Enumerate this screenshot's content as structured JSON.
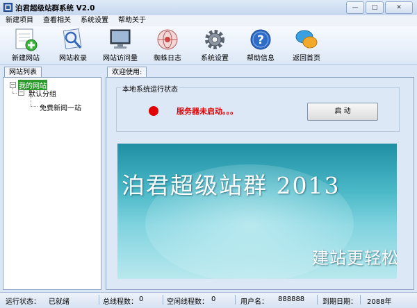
{
  "window": {
    "title": "泊君超级站群系统 V2.0",
    "buttons": {
      "minimize": "—",
      "maximize": "□",
      "close": "✕"
    }
  },
  "menu": [
    "新建项目",
    "查看相关",
    "系统设置",
    "帮助关于"
  ],
  "toolbar": [
    {
      "label": "新建网站",
      "icon": "new-site-icon"
    },
    {
      "label": "网站收录",
      "icon": "site-index-icon"
    },
    {
      "label": "网站访问量",
      "icon": "site-traffic-icon"
    },
    {
      "label": "蜘蛛日志",
      "icon": "spider-log-icon"
    },
    {
      "label": "系统设置",
      "icon": "gear-icon"
    },
    {
      "label": "帮助信息",
      "icon": "help-icon"
    },
    {
      "label": "返回首页",
      "icon": "home-chat-icon"
    }
  ],
  "left_panel": {
    "tab": "网站列表",
    "tree": {
      "root": "我的网站",
      "group": "默认分组",
      "site": "免费新闻一站"
    }
  },
  "right_panel": {
    "tab": "欢迎使用:",
    "group_title": "本地系统运行状态",
    "server_status": "服务器未启动。。。",
    "start_button": "启  动",
    "banner": {
      "title": "泊君超级站群 2013",
      "subtitle": "建站更轻松"
    }
  },
  "statusbar": {
    "run_status_label": "运行状态：",
    "run_status_value": "已就绪",
    "total_threads_label": "总线程数：",
    "total_threads_value": "0",
    "idle_threads_label": "空闲线程数：",
    "idle_threads_value": "0",
    "username_label": "用户名：",
    "username_value": "888888",
    "expire_label": "到期日期：",
    "expire_value": "2088年"
  },
  "colors": {
    "status_red": "#e00000",
    "tree_selection": "#2d9a2d",
    "banner_teal": "#4ab8c7"
  }
}
